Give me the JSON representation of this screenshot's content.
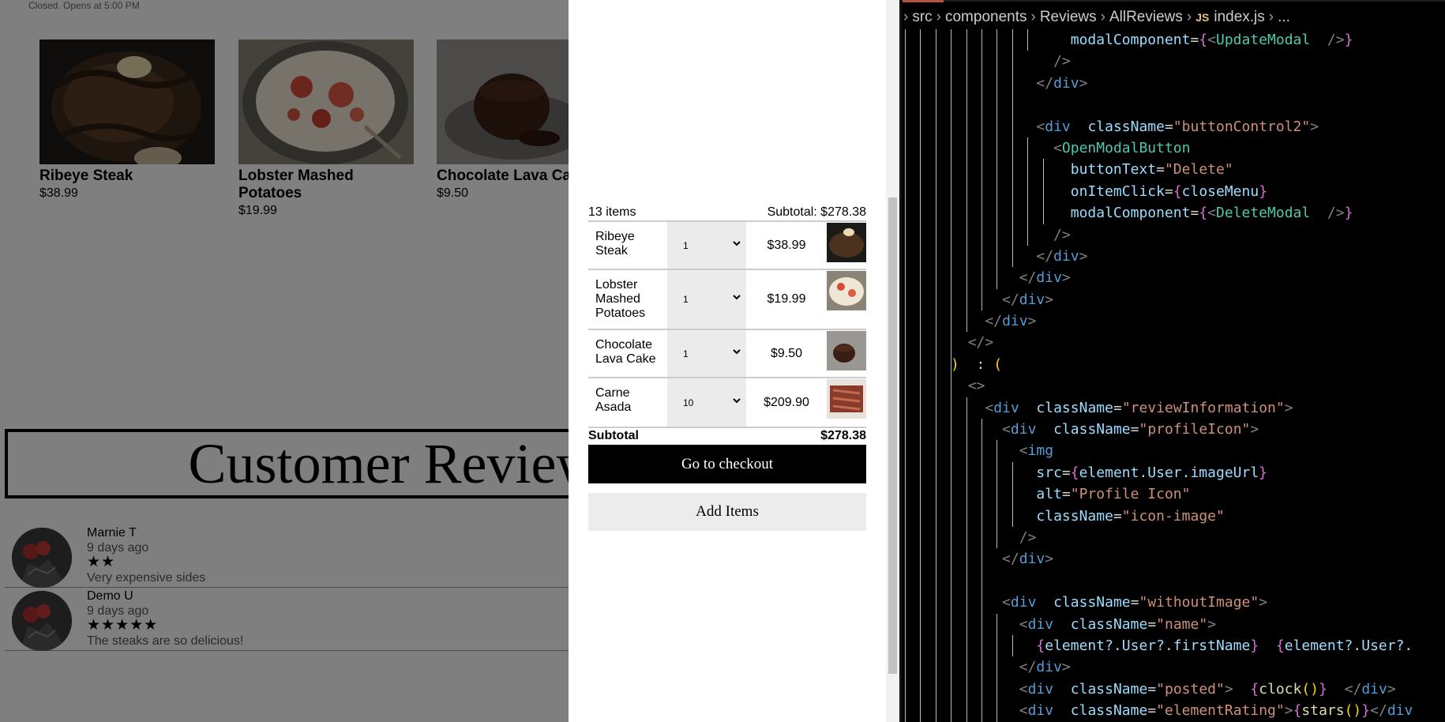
{
  "restaurant": {
    "hours_text": "Closed. Opens at 5:00 PM",
    "menu_items": [
      {
        "name": "Ribeye Steak",
        "price": "$38.99"
      },
      {
        "name": "Lobster Mashed Potatoes",
        "price": "$19.99"
      },
      {
        "name": "Chocolate Lava Cake",
        "price": "$9.50"
      }
    ],
    "reviews_title": "Customer Reviews",
    "reviews": [
      {
        "name": "Marnie T",
        "posted": "9 days ago",
        "stars": "★★",
        "rating": 2,
        "body": "Very expensive sides"
      },
      {
        "name": "Demo U",
        "posted": "9 days ago",
        "stars": "★★★★★",
        "rating": 5,
        "body": "The steaks are so delicious!"
      }
    ]
  },
  "cart": {
    "item_count": "13 items",
    "subtotal_header": "Subtotal: $278.38",
    "items": [
      {
        "name": "Ribeye Steak",
        "qty": "1",
        "price": "$38.99"
      },
      {
        "name": "Lobster Mashed Potatoes",
        "qty": "1",
        "price": "$19.99"
      },
      {
        "name": "Chocolate Lava Cake",
        "qty": "1",
        "price": "$9.50"
      },
      {
        "name": "Carne Asada",
        "qty": "10",
        "price": "$209.90"
      }
    ],
    "subtotal_label": "Subtotal",
    "subtotal_value": "$278.38",
    "checkout_label": "Go to checkout",
    "add_items_label": "Add Items"
  },
  "editor": {
    "breadcrumb": [
      "src",
      "components",
      "Reviews",
      "AllReviews"
    ],
    "file_badge": "JS",
    "file_name": "index.js",
    "breadcrumb_tail": "...",
    "lines": [
      {
        "guides": 9,
        "segs": [
          [
            "wt",
            "          "
          ],
          [
            "at",
            "modalComponent"
          ],
          [
            "wt",
            "="
          ],
          [
            "br",
            "{"
          ],
          [
            "tg",
            "<"
          ],
          [
            "cn",
            "UpdateModal"
          ],
          [
            "tg",
            " />"
          ],
          [
            "br",
            "}"
          ]
        ]
      },
      {
        "guides": 8,
        "segs": [
          [
            "wt",
            "         "
          ],
          [
            "tg",
            "/>"
          ]
        ]
      },
      {
        "guides": 8,
        "segs": [
          [
            "wt",
            "        "
          ],
          [
            "tg",
            "</"
          ],
          [
            "tn",
            "div"
          ],
          [
            "tg",
            ">"
          ]
        ]
      },
      {
        "guides": 8,
        "segs": [
          [
            "wt",
            ""
          ]
        ]
      },
      {
        "guides": 8,
        "segs": [
          [
            "wt",
            "        "
          ],
          [
            "tg",
            "<"
          ],
          [
            "tn",
            "div"
          ],
          [
            "wt",
            " "
          ],
          [
            "at",
            "className"
          ],
          [
            "wt",
            "="
          ],
          [
            "st",
            "\"buttonControl2\""
          ],
          [
            "tg",
            ">"
          ]
        ]
      },
      {
        "guides": 9,
        "segs": [
          [
            "wt",
            "         "
          ],
          [
            "tg",
            "<"
          ],
          [
            "cn",
            "OpenModalButton"
          ]
        ]
      },
      {
        "guides": 10,
        "segs": [
          [
            "wt",
            "          "
          ],
          [
            "at",
            "buttonText"
          ],
          [
            "wt",
            "="
          ],
          [
            "st",
            "\"Delete\""
          ]
        ]
      },
      {
        "guides": 10,
        "segs": [
          [
            "wt",
            "          "
          ],
          [
            "at",
            "onItemClick"
          ],
          [
            "wt",
            "="
          ],
          [
            "br",
            "{"
          ],
          [
            "vr",
            "closeMenu"
          ],
          [
            "br",
            "}"
          ]
        ]
      },
      {
        "guides": 10,
        "segs": [
          [
            "wt",
            "          "
          ],
          [
            "at",
            "modalComponent"
          ],
          [
            "wt",
            "="
          ],
          [
            "br",
            "{"
          ],
          [
            "tg",
            "<"
          ],
          [
            "cn",
            "DeleteModal"
          ],
          [
            "tg",
            " />"
          ],
          [
            "br",
            "}"
          ]
        ]
      },
      {
        "guides": 9,
        "segs": [
          [
            "wt",
            "         "
          ],
          [
            "tg",
            "/>"
          ]
        ]
      },
      {
        "guides": 8,
        "segs": [
          [
            "wt",
            "        "
          ],
          [
            "tg",
            "</"
          ],
          [
            "tn",
            "div"
          ],
          [
            "tg",
            ">"
          ]
        ]
      },
      {
        "guides": 7,
        "segs": [
          [
            "wt",
            "       "
          ],
          [
            "tg",
            "</"
          ],
          [
            "tn",
            "div"
          ],
          [
            "tg",
            ">"
          ]
        ]
      },
      {
        "guides": 6,
        "segs": [
          [
            "wt",
            "      "
          ],
          [
            "tg",
            "</"
          ],
          [
            "tn",
            "div"
          ],
          [
            "tg",
            ">"
          ]
        ]
      },
      {
        "guides": 5,
        "segs": [
          [
            "wt",
            "     "
          ],
          [
            "tg",
            "</"
          ],
          [
            "tn",
            "div"
          ],
          [
            "tg",
            ">"
          ]
        ]
      },
      {
        "guides": 4,
        "segs": [
          [
            "wt",
            "    "
          ],
          [
            "tg",
            "</>"
          ]
        ]
      },
      {
        "guides": 4,
        "segs": [
          [
            "wt",
            "   "
          ],
          [
            "by",
            ")"
          ],
          [
            "wt",
            " : "
          ],
          [
            "by",
            "("
          ]
        ]
      },
      {
        "guides": 4,
        "segs": [
          [
            "wt",
            "    "
          ],
          [
            "tg",
            "<>"
          ]
        ]
      },
      {
        "guides": 5,
        "segs": [
          [
            "wt",
            "     "
          ],
          [
            "tg",
            "<"
          ],
          [
            "tn",
            "div"
          ],
          [
            "wt",
            " "
          ],
          [
            "at",
            "className"
          ],
          [
            "wt",
            "="
          ],
          [
            "st",
            "\"reviewInformation\""
          ],
          [
            "tg",
            ">"
          ]
        ]
      },
      {
        "guides": 6,
        "segs": [
          [
            "wt",
            "      "
          ],
          [
            "tg",
            "<"
          ],
          [
            "tn",
            "div"
          ],
          [
            "wt",
            " "
          ],
          [
            "at",
            "className"
          ],
          [
            "wt",
            "="
          ],
          [
            "st",
            "\"profileIcon\""
          ],
          [
            "tg",
            ">"
          ]
        ]
      },
      {
        "guides": 7,
        "segs": [
          [
            "wt",
            "       "
          ],
          [
            "tg",
            "<"
          ],
          [
            "tn",
            "img"
          ]
        ]
      },
      {
        "guides": 8,
        "segs": [
          [
            "wt",
            "        "
          ],
          [
            "at",
            "src"
          ],
          [
            "wt",
            "="
          ],
          [
            "br",
            "{"
          ],
          [
            "vr",
            "element.User.imageUrl"
          ],
          [
            "br",
            "}"
          ]
        ]
      },
      {
        "guides": 8,
        "segs": [
          [
            "wt",
            "        "
          ],
          [
            "at",
            "alt"
          ],
          [
            "wt",
            "="
          ],
          [
            "st",
            "\"Profile Icon\""
          ]
        ]
      },
      {
        "guides": 8,
        "segs": [
          [
            "wt",
            "        "
          ],
          [
            "at",
            "className"
          ],
          [
            "wt",
            "="
          ],
          [
            "st",
            "\"icon-image\""
          ]
        ]
      },
      {
        "guides": 7,
        "segs": [
          [
            "wt",
            "       "
          ],
          [
            "tg",
            "/>"
          ]
        ]
      },
      {
        "guides": 6,
        "segs": [
          [
            "wt",
            "      "
          ],
          [
            "tg",
            "</"
          ],
          [
            "tn",
            "div"
          ],
          [
            "tg",
            ">"
          ]
        ]
      },
      {
        "guides": 6,
        "segs": [
          [
            "wt",
            ""
          ]
        ]
      },
      {
        "guides": 6,
        "segs": [
          [
            "wt",
            "      "
          ],
          [
            "tg",
            "<"
          ],
          [
            "tn",
            "div"
          ],
          [
            "wt",
            " "
          ],
          [
            "at",
            "className"
          ],
          [
            "wt",
            "="
          ],
          [
            "st",
            "\"withoutImage\""
          ],
          [
            "tg",
            ">"
          ]
        ]
      },
      {
        "guides": 7,
        "segs": [
          [
            "wt",
            "       "
          ],
          [
            "tg",
            "<"
          ],
          [
            "tn",
            "div"
          ],
          [
            "wt",
            " "
          ],
          [
            "at",
            "className"
          ],
          [
            "wt",
            "="
          ],
          [
            "st",
            "\"name\""
          ],
          [
            "tg",
            ">"
          ]
        ]
      },
      {
        "guides": 8,
        "segs": [
          [
            "wt",
            "        "
          ],
          [
            "br",
            "{"
          ],
          [
            "vr",
            "element?.User?.firstName"
          ],
          [
            "br",
            "}"
          ],
          [
            "wt",
            " "
          ],
          [
            "br",
            "{"
          ],
          [
            "vr",
            "element?.User?."
          ]
        ]
      },
      {
        "guides": 7,
        "segs": [
          [
            "wt",
            "       "
          ],
          [
            "tg",
            "</"
          ],
          [
            "tn",
            "div"
          ],
          [
            "tg",
            ">"
          ]
        ]
      },
      {
        "guides": 7,
        "segs": [
          [
            "wt",
            "       "
          ],
          [
            "tg",
            "<"
          ],
          [
            "tn",
            "div"
          ],
          [
            "wt",
            " "
          ],
          [
            "at",
            "className"
          ],
          [
            "wt",
            "="
          ],
          [
            "st",
            "\"posted\""
          ],
          [
            "tg",
            ">"
          ],
          [
            "wt",
            " "
          ],
          [
            "br",
            "{"
          ],
          [
            "fn",
            "clock"
          ],
          [
            "by",
            "()"
          ],
          [
            "br",
            "}"
          ],
          [
            "wt",
            " "
          ],
          [
            "tg",
            "</"
          ],
          [
            "tn",
            "div"
          ],
          [
            "tg",
            ">"
          ]
        ]
      },
      {
        "guides": 7,
        "segs": [
          [
            "wt",
            "       "
          ],
          [
            "tg",
            "<"
          ],
          [
            "tn",
            "div"
          ],
          [
            "wt",
            " "
          ],
          [
            "at",
            "className"
          ],
          [
            "wt",
            "="
          ],
          [
            "st",
            "\"elementRating\""
          ],
          [
            "tg",
            ">"
          ],
          [
            "br",
            "{"
          ],
          [
            "fn",
            "stars"
          ],
          [
            "by",
            "()"
          ],
          [
            "br",
            "}"
          ],
          [
            "tg",
            "</"
          ],
          [
            "tn",
            "div"
          ]
        ]
      }
    ]
  }
}
